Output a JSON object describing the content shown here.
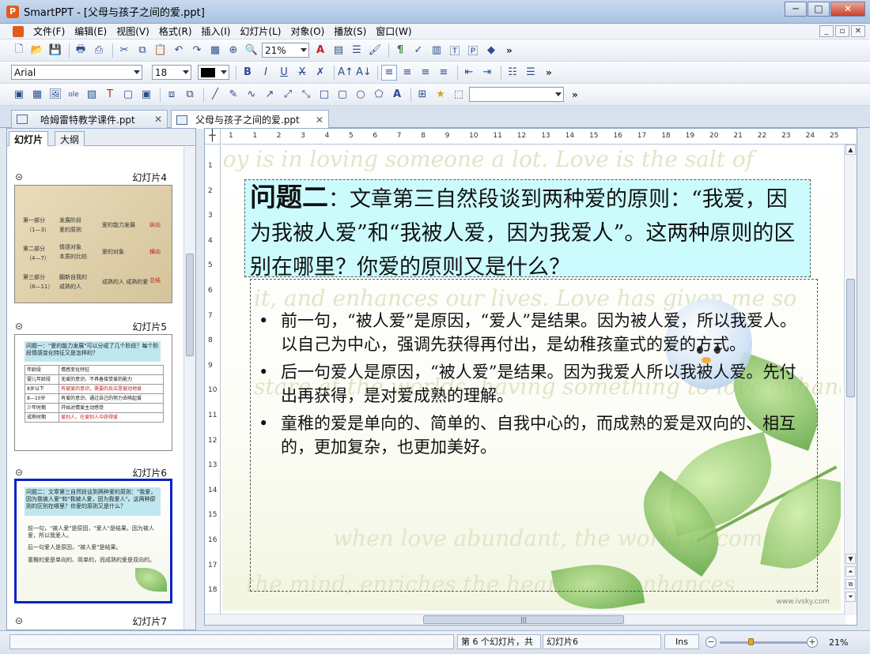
{
  "window": {
    "title": "SmartPPT - [父母与孩子之间的爱.ppt]",
    "controls": [
      "─",
      "□",
      "✕"
    ]
  },
  "menu": {
    "items": [
      "文件(F)",
      "编辑(E)",
      "视图(V)",
      "格式(R)",
      "插入(I)",
      "幻灯片(L)",
      "对象(O)",
      "播放(S)",
      "窗口(W)"
    ],
    "mdi_controls": [
      "_",
      "▫",
      "✕"
    ]
  },
  "toolbar": {
    "zoom_value": "21%",
    "font_name": "Arial",
    "font_size": "18",
    "chevron": "»"
  },
  "doc_tabs": [
    {
      "label": "哈姆雷特教学课件.ppt",
      "active": false
    },
    {
      "label": "父母与孩子之间的爱.ppt",
      "active": true
    }
  ],
  "left_panel": {
    "tabs": [
      "幻灯片",
      "大纲"
    ],
    "slides": [
      {
        "label": "幻灯片4"
      },
      {
        "label": "幻灯片5"
      },
      {
        "label": "幻灯片6"
      },
      {
        "label": "幻灯片7"
      }
    ],
    "thumb4": {
      "rows": [
        [
          "第一部分",
          "（1—3）",
          "爱的原则"
        ],
        [
          "第二部分",
          "（4—7）",
          "本质的比较"
        ],
        [
          "第三部分",
          "（8—11）",
          "成熟的人"
        ]
      ],
      "mid": [
        "发展阶段",
        "情感对象",
        "翻新自我的",
        "爱的能力发展",
        "爱的对象",
        "成熟的人 成熟的爱"
      ],
      "right": [
        "纵向",
        "横向",
        "总结"
      ]
    },
    "thumb5": {
      "title": "问题一：\"爱的能力发展\"可以分成了几个阶段？每个阶段情感变化特征又是怎样的？",
      "headers": [
        "年龄段",
        "情感变化特征"
      ],
      "rows": [
        [
          "婴儿年龄段",
          "无爱的意识，不具备接受爱的能力"
        ],
        [
          "8岁以下",
          "有被爱的意识，需要的反应是被动地爱"
        ],
        [
          "8—10岁",
          "有爱的意识，通过自己的努力去唤起爱"
        ],
        [
          "少年时期",
          "开始对情爱主动感受"
        ],
        [
          "成熟时期",
          "爱别人，在爱别人中获得爱"
        ]
      ]
    },
    "thumb6": {
      "title": "问题二：文章第三自然段谈到两种爱的原则：\"我爱，因为我被人爱\"和\"我被人爱，因为我爱人\"。这两种原则的区别在哪里？你爱的原则又是什么？",
      "bullets": [
        "前一句，\"被人爱\"是原因，\"爱人\"是结果。因为被人爱，所以我爱人。",
        "后一句爱人是原因，\"被人爱\"是结果。",
        "童稚的爱是单向的、简单的，而成熟的爱是双向的。"
      ]
    }
  },
  "slide": {
    "title_big": "问题二",
    "title_rest": "：文章第三自然段谈到两种爱的原则：“我爱，因为我被人爱”和“我被人爱，因为我爱人”。这两种原则的区别在哪里？你爱的原则又是什么？",
    "bullets": [
      "前一句，“被人爱”是原因，“爱人”是结果。因为被人爱，所以我爱人。以自己为中心，强调先获得再付出，是幼稚孩童式的爱的方式。",
      "后一句爱人是原因，“被人爱”是结果。因为我爱人所以我被人爱。先付出再获得，是对爱成熟的理解。",
      "童稚的爱是单向的、简单的、自我中心的，而成熟的爱是双向的、相互的，更加复杂，也更加美好。"
    ],
    "bullet_glyph": "•",
    "watermark": "www.ivsky.com",
    "bg_lines": [
      "joy is in loving someone a lot. Love is the salt of",
      "it, and enhances our lives. Love has given me so",
      "stare at the worlds, having something to love enhanc",
      "when love abundant, the world becomes",
      "the mind, enriches the heart, and enhances"
    ]
  },
  "ruler": {
    "h_ticks": [
      "1",
      "1",
      "2",
      "3",
      "4",
      "5",
      "6",
      "7",
      "8",
      "9",
      "10",
      "11",
      "12",
      "13",
      "14",
      "15",
      "16",
      "17",
      "18",
      "19",
      "20",
      "21",
      "22",
      "23",
      "24",
      "25"
    ],
    "v_ticks": [
      "1",
      "2",
      "3",
      "4",
      "5",
      "6",
      "7",
      "8",
      "9",
      "10",
      "11",
      "12",
      "13",
      "14",
      "15",
      "16",
      "17",
      "18"
    ],
    "corner": "┼"
  },
  "status": {
    "slide_info": "第 6 个幻灯片，共",
    "slide_name": "幻灯片6",
    "mode": "Ins",
    "zoom": "21%",
    "zoom_fraction": 0.35
  },
  "colors": {
    "title_box": "#ccfbfd",
    "selection_border": "#0a22c8",
    "accent_orange": "#e25b1c"
  }
}
